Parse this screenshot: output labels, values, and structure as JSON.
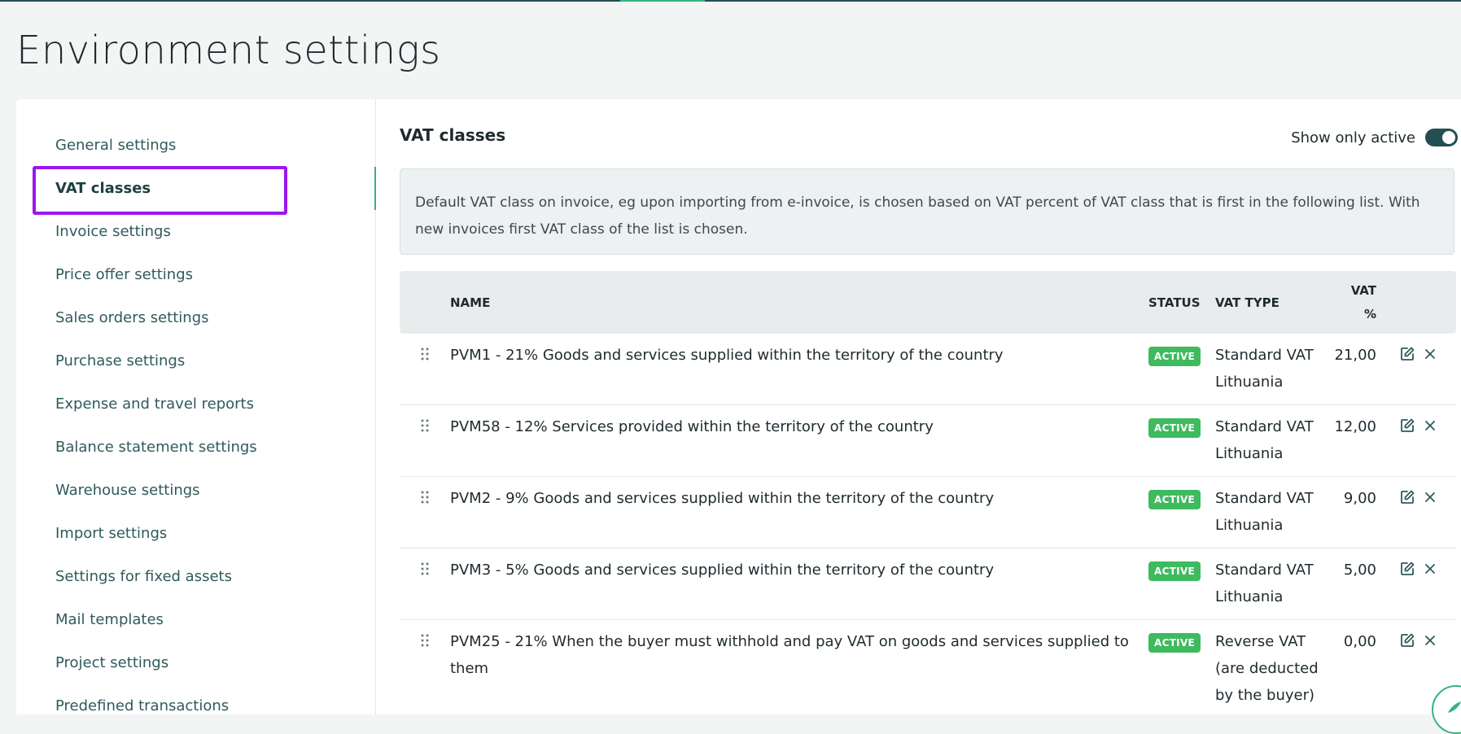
{
  "page": {
    "title": "Environment settings"
  },
  "sidebar": {
    "items": [
      {
        "label": "General settings"
      },
      {
        "label": "VAT classes",
        "active": true
      },
      {
        "label": "Invoice settings"
      },
      {
        "label": "Price offer settings"
      },
      {
        "label": "Sales orders settings"
      },
      {
        "label": "Purchase settings"
      },
      {
        "label": "Expense and travel reports"
      },
      {
        "label": "Balance statement settings"
      },
      {
        "label": "Warehouse settings"
      },
      {
        "label": "Import settings"
      },
      {
        "label": "Settings for fixed assets"
      },
      {
        "label": "Mail templates"
      },
      {
        "label": "Project settings"
      },
      {
        "label": "Predefined transactions"
      }
    ]
  },
  "content": {
    "section_title": "VAT classes",
    "toggle": {
      "label": "Show only active",
      "on": true
    },
    "info": "Default VAT class on invoice, eg upon importing from e-invoice, is chosen based on VAT percent of VAT class that is first in the following list. With new invoices first VAT class of the list is chosen."
  },
  "table": {
    "headers": {
      "name": "NAME",
      "status": "STATUS",
      "vat_type": "VAT TYPE",
      "vat_percent_line1": "VAT",
      "vat_percent_line2": "%"
    },
    "rows": [
      {
        "name": "PVM1 - 21% Goods and services supplied within the territory of the country",
        "status": "ACTIVE",
        "vat_type": "Standard VAT Lithuania",
        "vat": "21,00"
      },
      {
        "name": "PVM58 - 12% Services provided within the territory of the country",
        "status": "ACTIVE",
        "vat_type": "Standard VAT Lithuania",
        "vat": "12,00"
      },
      {
        "name": "PVM2 - 9% Goods and services supplied within the territory of the country",
        "status": "ACTIVE",
        "vat_type": "Standard VAT Lithuania",
        "vat": "9,00"
      },
      {
        "name": "PVM3 - 5% Goods and services supplied within the territory of the country",
        "status": "ACTIVE",
        "vat_type": "Standard VAT Lithuania",
        "vat": "5,00"
      },
      {
        "name": "PVM25 - 21% When the buyer must withhold and pay VAT on goods and services supplied to them",
        "status": "ACTIVE",
        "vat_type": "Reverse VAT (are deducted by the buyer)",
        "vat": "0,00"
      }
    ]
  },
  "colors": {
    "accent": "#36b37e",
    "dark": "#234f53",
    "badge": "#3fba5f",
    "highlight": "#9b16f0"
  },
  "icons": [
    "drag-handle-icon",
    "edit-icon",
    "close-icon",
    "toggle-switch",
    "help-chat-icon"
  ]
}
